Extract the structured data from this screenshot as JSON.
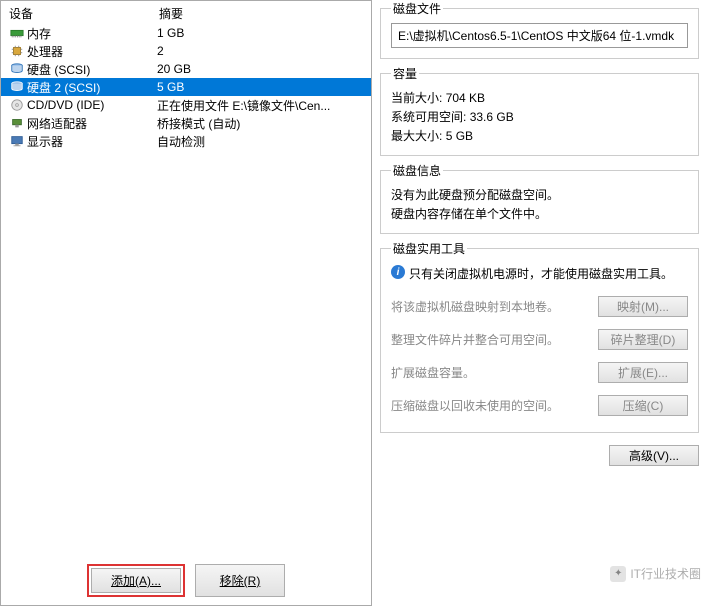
{
  "headers": {
    "device": "设备",
    "summary": "摘要"
  },
  "devices": [
    {
      "name": "内存",
      "summary": "1 GB",
      "icon": "memory-icon",
      "selected": false
    },
    {
      "name": "处理器",
      "summary": "2",
      "icon": "cpu-icon",
      "selected": false
    },
    {
      "name": "硬盘 (SCSI)",
      "summary": "20 GB",
      "icon": "disk-icon",
      "selected": false
    },
    {
      "name": "硬盘 2 (SCSI)",
      "summary": "5 GB",
      "icon": "disk-icon",
      "selected": true
    },
    {
      "name": "CD/DVD (IDE)",
      "summary": "正在使用文件 E:\\镜像文件\\Cen...",
      "icon": "cd-icon",
      "selected": false
    },
    {
      "name": "网络适配器",
      "summary": "桥接模式 (自动)",
      "icon": "net-icon",
      "selected": false
    },
    {
      "name": "显示器",
      "summary": "自动检测",
      "icon": "display-icon",
      "selected": false
    }
  ],
  "buttons": {
    "add": "添加(A)...",
    "remove": "移除(R)"
  },
  "disk_file": {
    "legend": "磁盘文件",
    "path": "E:\\虚拟机\\Centos6.5-1\\CentOS 中文版64 位-1.vmdk"
  },
  "capacity": {
    "legend": "容量",
    "current_label": "当前大小:",
    "current_value": "704 KB",
    "free_label": "系统可用空间:",
    "free_value": "33.6 GB",
    "max_label": "最大大小:",
    "max_value": "5 GB"
  },
  "disk_info": {
    "legend": "磁盘信息",
    "lines": [
      "没有为此硬盘预分配磁盘空间。",
      "硬盘内容存储在单个文件中。"
    ]
  },
  "utils": {
    "legend": "磁盘实用工具",
    "hint": "只有关闭虚拟机电源时，才能使用磁盘实用工具。",
    "items": [
      {
        "text": "将该虚拟机磁盘映射到本地卷。",
        "btn": "映射(M)...",
        "enabled": false
      },
      {
        "text": "整理文件碎片并整合可用空间。",
        "btn": "碎片整理(D)",
        "enabled": false
      },
      {
        "text": "扩展磁盘容量。",
        "btn": "扩展(E)...",
        "enabled": false
      },
      {
        "text": "压缩磁盘以回收未使用的空间。",
        "btn": "压缩(C)",
        "enabled": false
      }
    ]
  },
  "advanced": "高级(V)...",
  "watermark": "IT行业技术圈"
}
